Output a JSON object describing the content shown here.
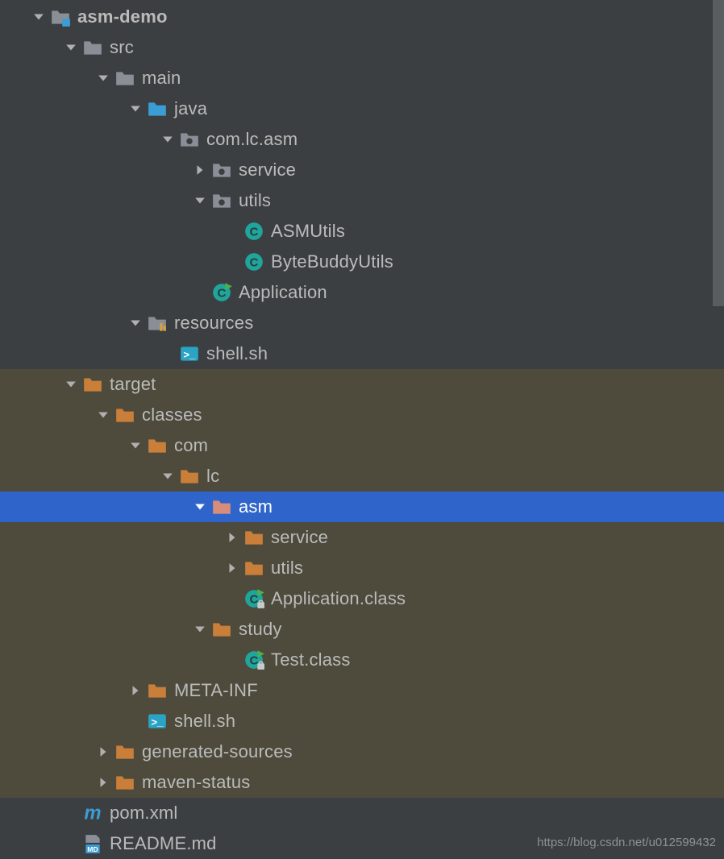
{
  "watermark": "https://blog.csdn.net/u012599432",
  "rows": [
    {
      "indent": 0,
      "arrow": "down",
      "icon": "module",
      "label": "asm-demo",
      "bold": true,
      "hl": false,
      "sel": false
    },
    {
      "indent": 1,
      "arrow": "down",
      "icon": "folder-gray",
      "label": "src",
      "hl": false,
      "sel": false
    },
    {
      "indent": 2,
      "arrow": "down",
      "icon": "folder-gray",
      "label": "main",
      "hl": false,
      "sel": false
    },
    {
      "indent": 3,
      "arrow": "down",
      "icon": "folder-source",
      "label": "java",
      "hl": false,
      "sel": false
    },
    {
      "indent": 4,
      "arrow": "down",
      "icon": "package",
      "label": "com.lc.asm",
      "hl": false,
      "sel": false
    },
    {
      "indent": 5,
      "arrow": "right",
      "icon": "package",
      "label": "service",
      "hl": false,
      "sel": false
    },
    {
      "indent": 5,
      "arrow": "down",
      "icon": "package",
      "label": "utils",
      "hl": false,
      "sel": false
    },
    {
      "indent": 6,
      "arrow": "none",
      "icon": "class",
      "label": "ASMUtils",
      "hl": false,
      "sel": false
    },
    {
      "indent": 6,
      "arrow": "none",
      "icon": "class",
      "label": "ByteBuddyUtils",
      "hl": false,
      "sel": false
    },
    {
      "indent": 5,
      "arrow": "none",
      "icon": "class-run",
      "label": "Application",
      "hl": false,
      "sel": false
    },
    {
      "indent": 3,
      "arrow": "down",
      "icon": "folder-resources",
      "label": "resources",
      "hl": false,
      "sel": false
    },
    {
      "indent": 4,
      "arrow": "none",
      "icon": "shell",
      "label": "shell.sh",
      "hl": false,
      "sel": false
    },
    {
      "indent": 1,
      "arrow": "down",
      "icon": "folder-orange",
      "label": "target",
      "hl": true,
      "sel": false
    },
    {
      "indent": 2,
      "arrow": "down",
      "icon": "folder-orange",
      "label": "classes",
      "hl": true,
      "sel": false
    },
    {
      "indent": 3,
      "arrow": "down",
      "icon": "folder-orange",
      "label": "com",
      "hl": true,
      "sel": false
    },
    {
      "indent": 4,
      "arrow": "down",
      "icon": "folder-orange",
      "label": "lc",
      "hl": true,
      "sel": false
    },
    {
      "indent": 5,
      "arrow": "down",
      "icon": "folder-orange-sel",
      "label": "asm",
      "hl": false,
      "sel": true
    },
    {
      "indent": 6,
      "arrow": "right",
      "icon": "folder-orange",
      "label": "service",
      "hl": true,
      "sel": false
    },
    {
      "indent": 6,
      "arrow": "right",
      "icon": "folder-orange",
      "label": "utils",
      "hl": true,
      "sel": false
    },
    {
      "indent": 6,
      "arrow": "none",
      "icon": "class-run-lock",
      "label": "Application.class",
      "hl": true,
      "sel": false
    },
    {
      "indent": 5,
      "arrow": "down",
      "icon": "folder-orange",
      "label": "study",
      "hl": true,
      "sel": false
    },
    {
      "indent": 6,
      "arrow": "none",
      "icon": "class-run-lock",
      "label": "Test.class",
      "hl": true,
      "sel": false
    },
    {
      "indent": 3,
      "arrow": "right",
      "icon": "folder-orange",
      "label": "META-INF",
      "hl": true,
      "sel": false
    },
    {
      "indent": 3,
      "arrow": "none",
      "icon": "shell",
      "label": "shell.sh",
      "hl": true,
      "sel": false
    },
    {
      "indent": 2,
      "arrow": "right",
      "icon": "folder-orange",
      "label": "generated-sources",
      "hl": true,
      "sel": false
    },
    {
      "indent": 2,
      "arrow": "right",
      "icon": "folder-orange",
      "label": "maven-status",
      "hl": true,
      "sel": false
    },
    {
      "indent": 1,
      "arrow": "none",
      "icon": "maven",
      "label": "pom.xml",
      "hl": false,
      "sel": false
    },
    {
      "indent": 1,
      "arrow": "none",
      "icon": "markdown",
      "label": "README.md",
      "hl": false,
      "sel": false
    }
  ]
}
